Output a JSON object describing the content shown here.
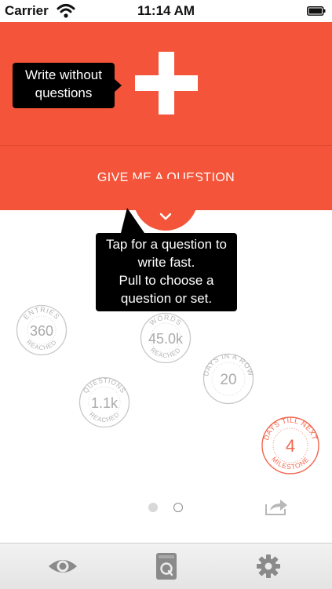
{
  "status_bar": {
    "carrier": "Carrier",
    "time": "11:14 AM",
    "icons": [
      "wifi-icon",
      "battery-icon"
    ]
  },
  "header": {
    "new_entry_icon": "plus-icon",
    "give_question_label": "GIVE ME A QUESTION",
    "pull_tab_icon": "chevron-down-icon",
    "accent_color": "#f4553a"
  },
  "tooltips": {
    "write": [
      "Write without",
      "questions"
    ],
    "question": [
      "Tap for a question to",
      "write fast.",
      "Pull to choose a",
      "question or set."
    ]
  },
  "stats": {
    "entries": {
      "top": "ENTRIES",
      "value": "360",
      "bottom": "REACHED"
    },
    "words": {
      "top": "WORDS",
      "value": "45.0k",
      "bottom": "REACHED"
    },
    "days_in_a_row": {
      "top": "DAYS IN A ROW",
      "value": "20"
    },
    "questions": {
      "top": "QUESTIONS",
      "value": "1.1k",
      "bottom": "REACHED"
    },
    "milestone": {
      "top": "DAYS TILL NEXT",
      "value": "4",
      "bottom": "MILESTONE"
    }
  },
  "pager": {
    "pages": 2,
    "current": 1
  },
  "tab_bar": [
    "eye-icon",
    "q-card-icon",
    "gear-icon"
  ],
  "colors": {
    "stamp_gray": "#c8c8c8",
    "stamp_red": "#f1664d"
  }
}
